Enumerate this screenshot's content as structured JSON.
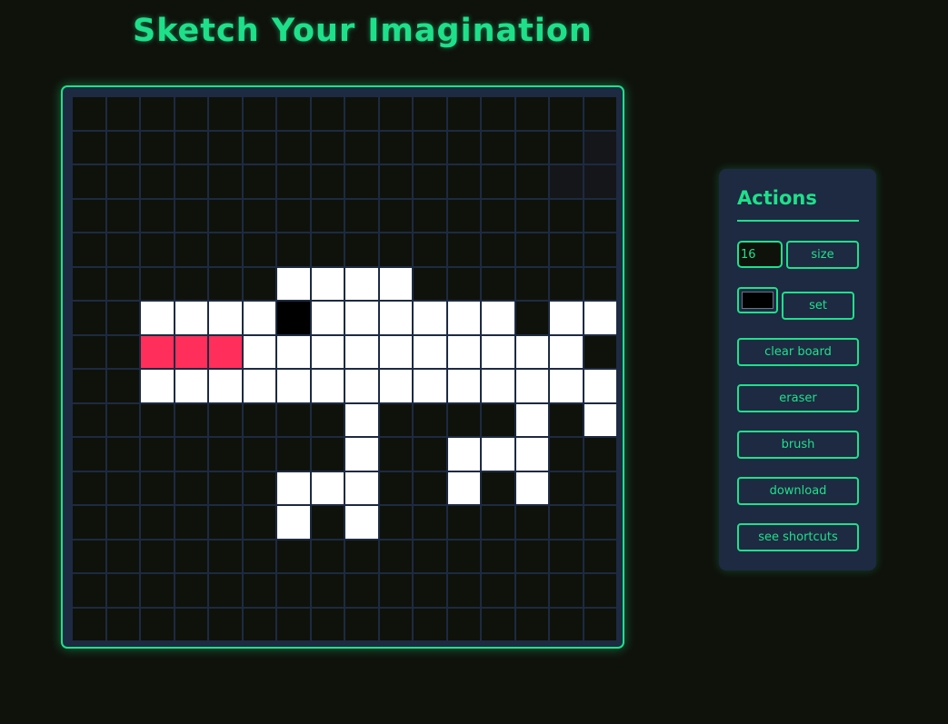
{
  "page_title": "Sketch Your Imagination",
  "board": {
    "size": 16,
    "background": "#0f120b",
    "palette": {
      "W": "#ffffff",
      "R": "#ff2e5a",
      "K": "#000000",
      "D": "#151619"
    },
    "rows": [
      "................",
      "...............D",
      "..............DD",
      "................",
      "................",
      "......WWWW......",
      "..WWWWKWWWWWW.WW",
      "..RRRWWWWWWWWWW.",
      "..WWWWWWWWWWWWWW",
      "........W....W.W",
      "........W..WWW..",
      "......WWW..W.W..",
      "......W.W.......",
      "................",
      "................",
      "................"
    ]
  },
  "actions": {
    "title": "Actions",
    "grid_size_value": "16",
    "size_label": "size",
    "selected_color": "#000000",
    "set_label": "set",
    "clear_label": "clear board",
    "eraser_label": "eraser",
    "brush_label": "brush",
    "download_label": "download",
    "shortcuts_label": "see shortcuts"
  }
}
